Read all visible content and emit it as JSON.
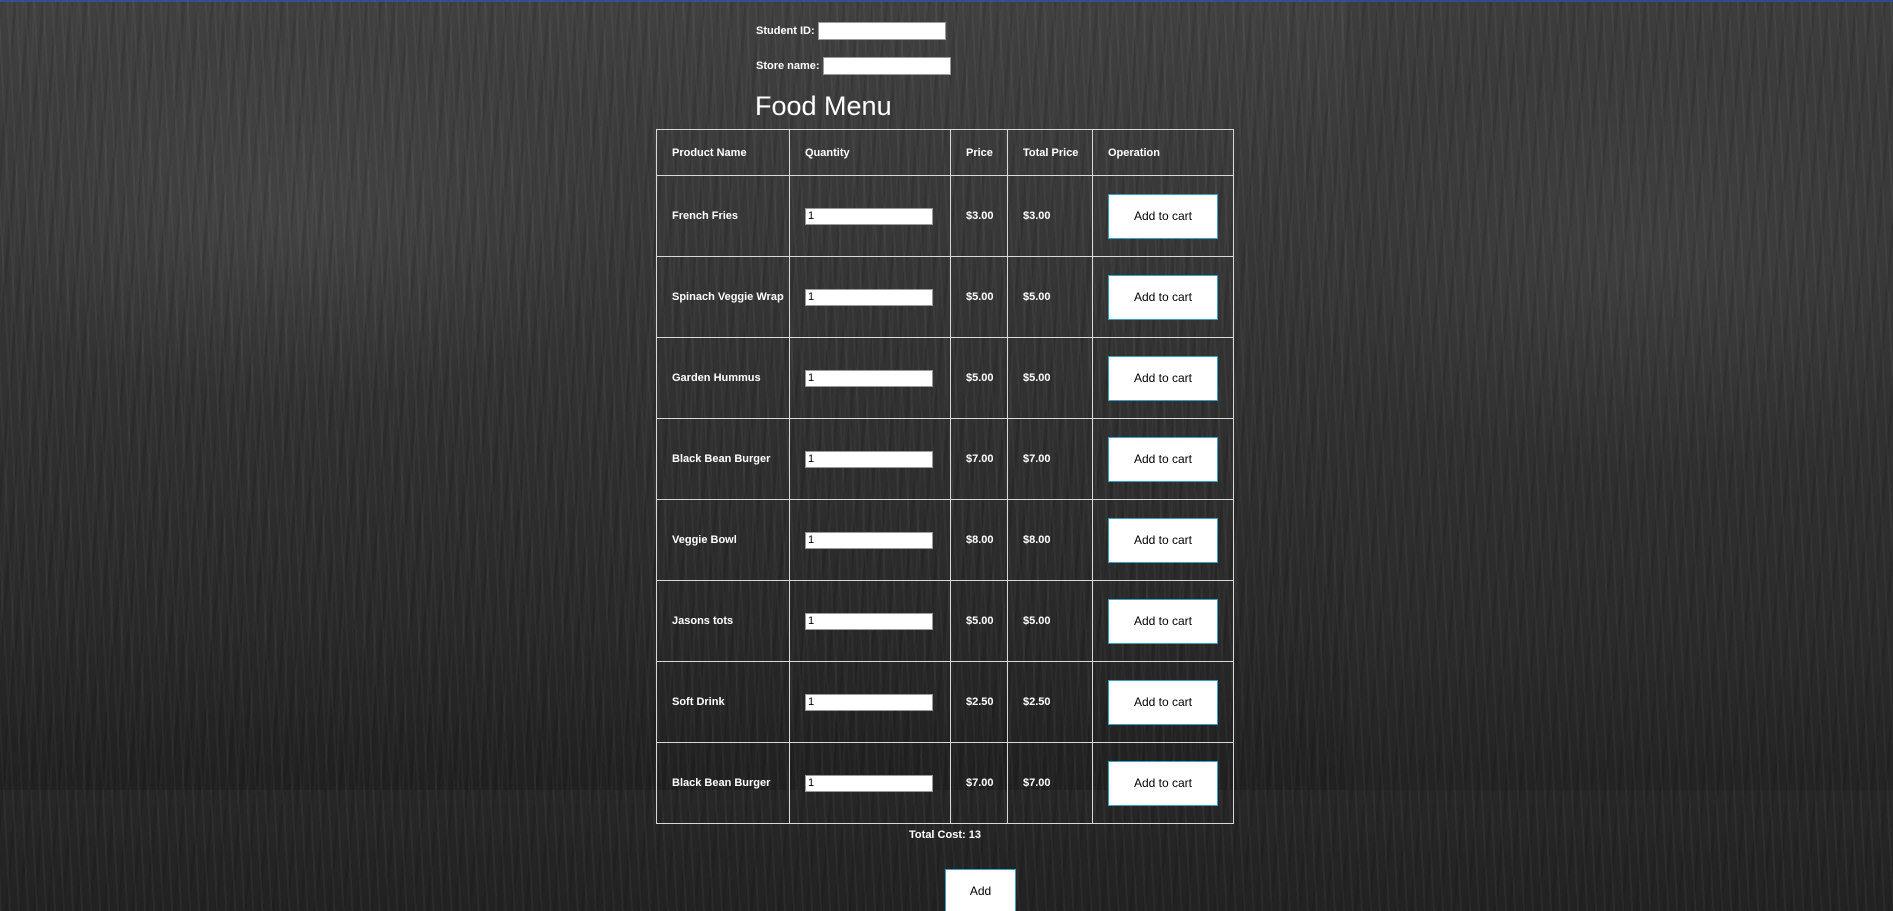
{
  "form": {
    "student_id_label": "Student ID:",
    "student_id_value": "",
    "store_name_label": "Store name:",
    "store_name_value": ""
  },
  "title": "Food Menu",
  "table": {
    "headers": [
      "Product Name",
      "Quantity",
      "Price",
      "Total Price",
      "Operation"
    ],
    "rows": [
      {
        "name": "French Fries",
        "qty": "1",
        "price": "$3.00",
        "total": "$3.00",
        "action": "Add to cart"
      },
      {
        "name": "Spinach Veggie Wrap",
        "qty": "1",
        "price": "$5.00",
        "total": "$5.00",
        "action": "Add to cart"
      },
      {
        "name": "Garden Hummus",
        "qty": "1",
        "price": "$5.00",
        "total": "$5.00",
        "action": "Add to cart"
      },
      {
        "name": "Black Bean Burger",
        "qty": "1",
        "price": "$7.00",
        "total": "$7.00",
        "action": "Add to cart"
      },
      {
        "name": "Veggie Bowl",
        "qty": "1",
        "price": "$8.00",
        "total": "$8.00",
        "action": "Add to cart"
      },
      {
        "name": "Jasons tots",
        "qty": "1",
        "price": "$5.00",
        "total": "$5.00",
        "action": "Add to cart"
      },
      {
        "name": "Soft Drink",
        "qty": "1",
        "price": "$2.50",
        "total": "$2.50",
        "action": "Add to cart"
      },
      {
        "name": "Black Bean Burger",
        "qty": "1",
        "price": "$7.00",
        "total": "$7.00",
        "action": "Add to cart"
      }
    ]
  },
  "total_cost": "Total Cost: 13",
  "add_label": "Add",
  "colors": {
    "header_bar": "#2b4a8a",
    "button_border": "#3aa0c8",
    "text": "#ffffff"
  }
}
